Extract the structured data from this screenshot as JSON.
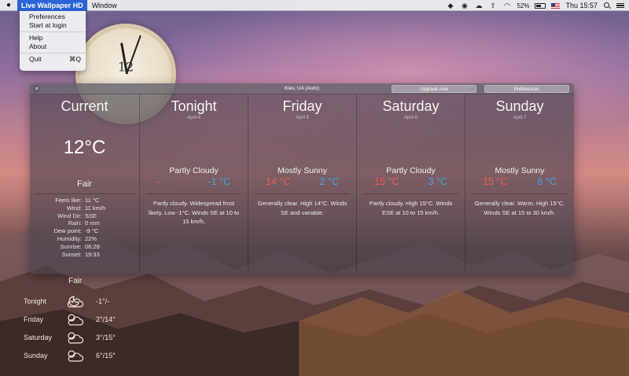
{
  "menubar": {
    "apple": "",
    "app_name": "Live Wallpaper HD",
    "window_menu": "Window",
    "battery_percent": "52%",
    "battery_level": 0.52,
    "time": "Thu 15:57"
  },
  "app_menu": {
    "items": [
      {
        "label": "Preferences"
      },
      {
        "label": "Start at login"
      },
      {
        "label": "Help"
      },
      {
        "label": "About"
      },
      {
        "label": "Quit",
        "shortcut": "⌘Q"
      }
    ]
  },
  "desktop_clock": {
    "number": "12"
  },
  "widget": {
    "location": "Kiev, UA (Auto)",
    "upgrade_label": "Upgrade now",
    "preferences_label": "Preferences",
    "current": {
      "title": "Current",
      "temp": "12°C",
      "condition": "Fair",
      "details": [
        {
          "label": "Feels like:",
          "value": "11 °C"
        },
        {
          "label": "Wind:",
          "value": "11 km/h"
        },
        {
          "label": "Wind Dir:",
          "value": "SSE"
        },
        {
          "label": "Rain:",
          "value": "0 mm"
        },
        {
          "label": "Dew point:",
          "value": "-9 °C"
        },
        {
          "label": "Humidity:",
          "value": "22%"
        },
        {
          "label": "Sunrise:",
          "value": "06:28"
        },
        {
          "label": "Sunset:",
          "value": "19:33"
        }
      ]
    },
    "days": [
      {
        "title": "Tonight",
        "date": "April 4",
        "condition": "Partly Cloudy",
        "high": "-",
        "low": "-1 °C",
        "forecast": "Partly cloudy. Widespread frost likely. Low -1°C. Winds SE at 10 to 15 km/h."
      },
      {
        "title": "Friday",
        "date": "April 5",
        "condition": "Mostly Sunny",
        "high": "14 °C",
        "low": "2 °C",
        "forecast": "Generally clear. High 14°C. Winds SE and variable."
      },
      {
        "title": "Saturday",
        "date": "April 6",
        "condition": "Partly Cloudy",
        "high": "15 °C",
        "low": "3 °C",
        "forecast": "Partly cloudy. High 15°C. Winds ESE at 10 to 15 km/h."
      },
      {
        "title": "Sunday",
        "date": "April 7",
        "condition": "Mostly Sunny",
        "high": "15 °C",
        "low": "6 °C",
        "forecast": "Generally clear. Warm. High 15°C. Winds SE at 15 to 30 km/h."
      }
    ]
  },
  "desktop_forecast": {
    "header": "Fair",
    "rows": [
      {
        "day": "Tonight",
        "temp": "-1°/-"
      },
      {
        "day": "Friday",
        "temp": "2°/14°"
      },
      {
        "day": "Saturday",
        "temp": "3°/15°"
      },
      {
        "day": "Sunday",
        "temp": "6°/15°"
      }
    ]
  },
  "colors": {
    "menu_highlight": "#2b63d9",
    "high_temp": "#f25a4a",
    "low_temp": "#3fa3f0"
  }
}
